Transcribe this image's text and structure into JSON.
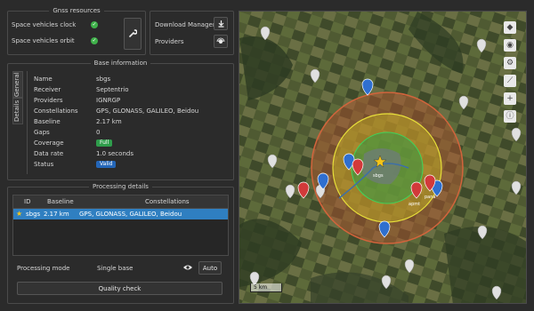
{
  "gnss": {
    "title": "Gnss resources",
    "items": [
      {
        "label": "Space vehicles clock"
      },
      {
        "label": "Space vehicles orbit"
      }
    ]
  },
  "right_top": {
    "download_manager": "Download Manager",
    "providers": "Providers"
  },
  "base_info": {
    "title": "Base information",
    "tabs": [
      "General",
      "Details"
    ],
    "rows": [
      {
        "key": "Name",
        "value": "sbgs"
      },
      {
        "key": "Receiver",
        "value": "Septentrio"
      },
      {
        "key": "Providers",
        "value": "IGNRGP"
      },
      {
        "key": "Constellations",
        "value": "GPS, GLONASS, GALILEO, Beidou"
      },
      {
        "key": "Baseline",
        "value": "2.17 km"
      },
      {
        "key": "Gaps",
        "value": "0"
      },
      {
        "key": "Coverage",
        "value": "Full"
      },
      {
        "key": "Data rate",
        "value": "1.0 seconds"
      },
      {
        "key": "Status",
        "value": "Valid"
      }
    ]
  },
  "processing": {
    "title": "Processing details",
    "columns": [
      "ID",
      "Baseline",
      "Constellations"
    ],
    "rows": [
      {
        "id": "sbgs",
        "baseline": "2.17 km",
        "constellations": "GPS, GLONASS, GALILEO, Beidou"
      }
    ],
    "mode_label": "Processing mode",
    "mode_value": "Single base",
    "auto_label": "Auto",
    "quality_check": "Quality check"
  },
  "map": {
    "scale_label": "5 km",
    "labels": [
      "sbgs",
      "pana",
      "apmt",
      "pana"
    ]
  },
  "colors": {
    "accent": "#2f7fc1",
    "ok": "#3fb14a",
    "full_badge": "#2e9d4b",
    "valid_badge": "#2466b8"
  }
}
